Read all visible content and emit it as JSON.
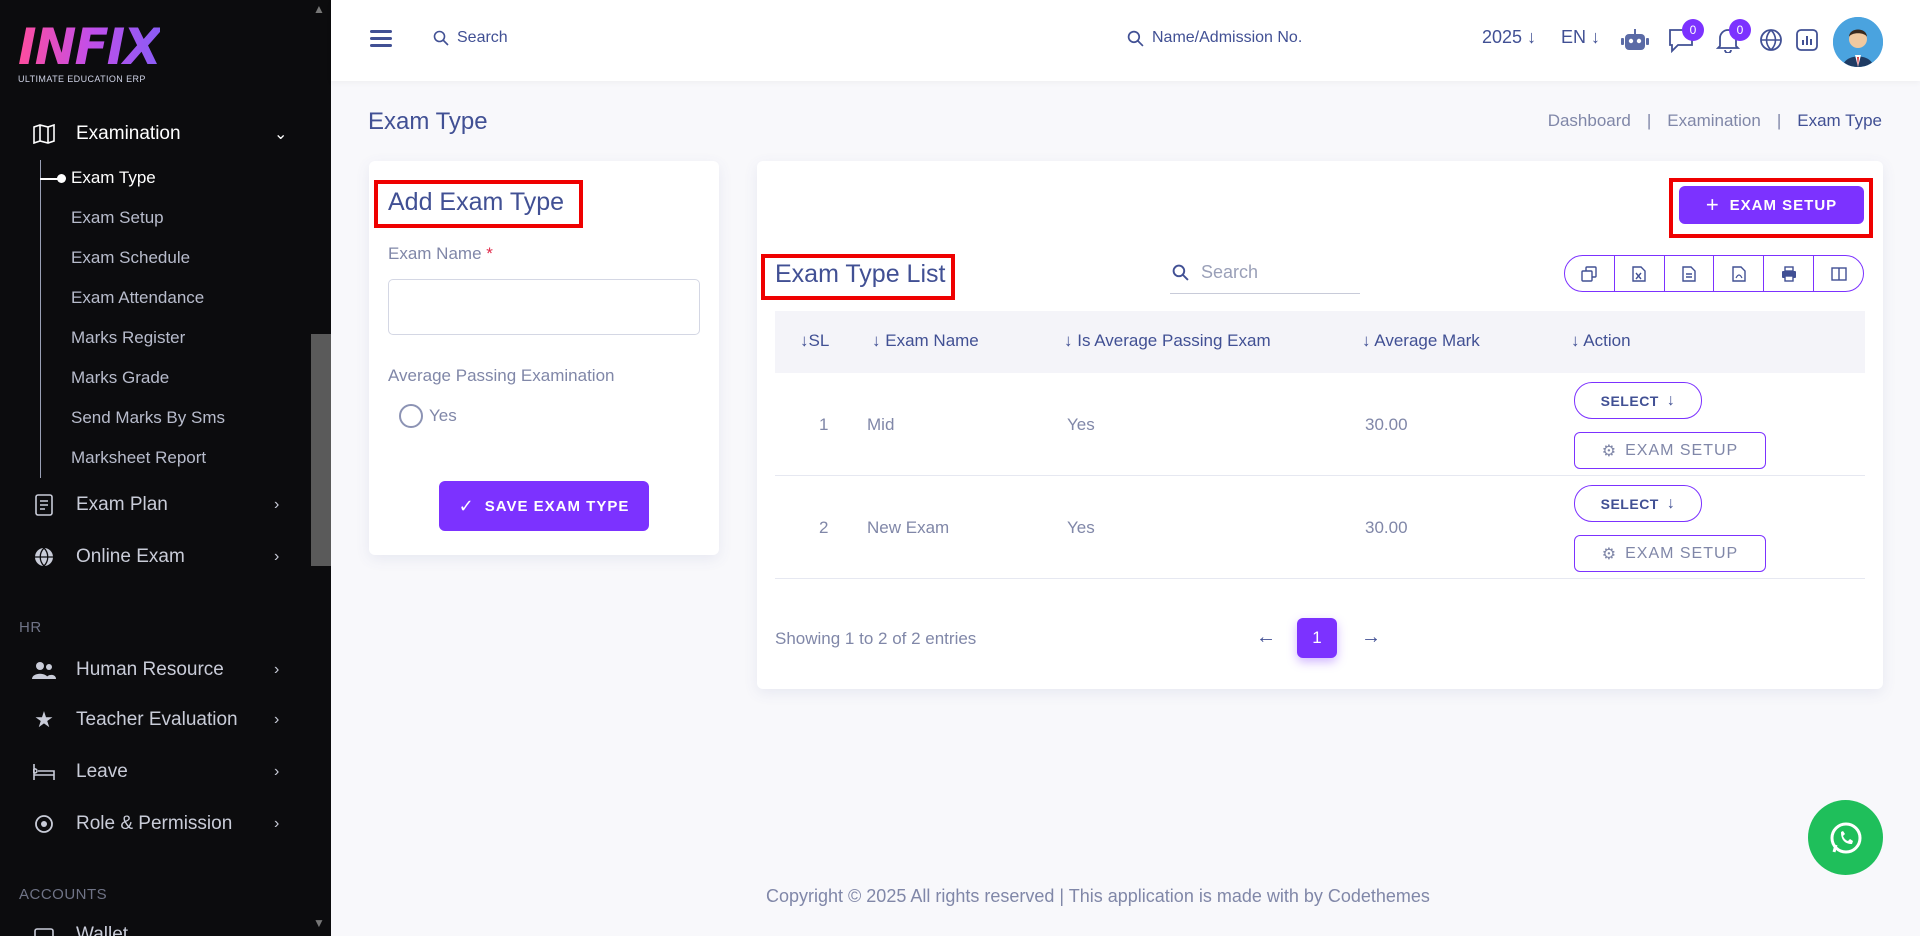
{
  "sidebar": {
    "logo": "INFIX",
    "logo_sub": "ULTIMATE EDUCATION ERP",
    "examination": "Examination",
    "subitems": [
      "Exam Type",
      "Exam Setup",
      "Exam Schedule",
      "Exam Attendance",
      "Marks Register",
      "Marks Grade",
      "Send Marks By Sms",
      "Marksheet Report"
    ],
    "exam_plan": "Exam Plan",
    "online_exam": "Online Exam",
    "section_hr": "HR",
    "human_resource": "Human Resource",
    "teacher_evaluation": "Teacher Evaluation",
    "leave": "Leave",
    "role_permission": "Role & Permission",
    "section_accounts": "ACCOUNTS",
    "wallet": "Wallet"
  },
  "header": {
    "search_label": "Search",
    "student_search_label": "Name/Admission No.",
    "year": "2025",
    "language": "EN",
    "messages_count": "0",
    "notifications_count": "0"
  },
  "page": {
    "title": "Exam Type",
    "breadcrumb": [
      "Dashboard",
      "Examination",
      "Exam Type"
    ]
  },
  "add_form": {
    "title": "Add Exam Type",
    "exam_name_label": "Exam Name",
    "required_mark": "*",
    "exam_name_value": "",
    "avg_passing_label": "Average Passing Examination",
    "yes_label": "Yes",
    "save_button": "SAVE EXAM TYPE"
  },
  "list": {
    "exam_setup_button": "EXAM SETUP",
    "title": "Exam Type List",
    "search_placeholder": "Search",
    "columns": [
      "SL",
      "Exam Name",
      "Is Average Passing Exam",
      "Average Mark",
      "Action"
    ],
    "rows": [
      {
        "sl": "1",
        "exam_name": "Mid",
        "is_avg": "Yes",
        "avg_mark": "30.00"
      },
      {
        "sl": "2",
        "exam_name": "New Exam",
        "is_avg": "Yes",
        "avg_mark": "30.00"
      }
    ],
    "select_label": "SELECT",
    "row_exam_setup_label": "EXAM SETUP",
    "showing": "Showing 1 to 2 of 2 entries",
    "current_page": "1"
  },
  "footer": {
    "text": "Copyright © 2025 All rights reserved | This application is made with by Codethemes"
  },
  "colors": {
    "accent": "#7c32ff",
    "text": "#415094",
    "highlight": "#ef0000",
    "whatsapp": "#1fbf5b"
  }
}
